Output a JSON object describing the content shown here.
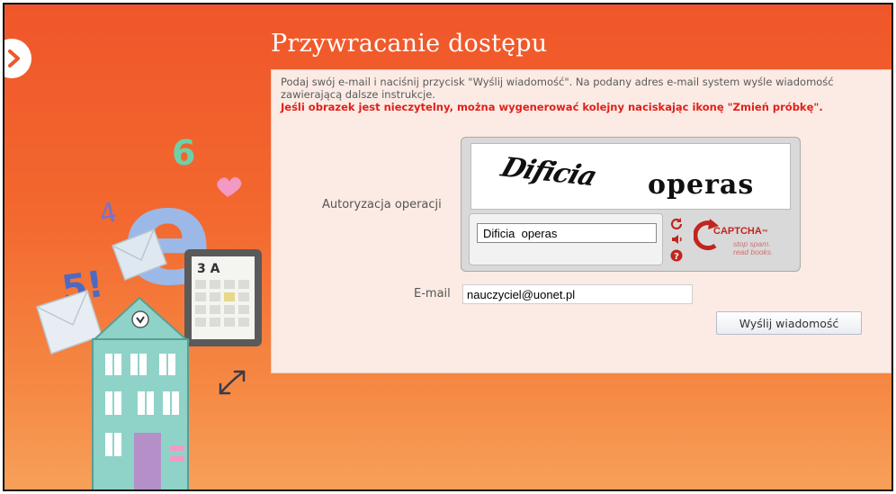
{
  "page": {
    "title": "Przywracanie dostępu",
    "info_text": "Podaj swój e-mail i naciśnij przycisk \"Wyślij wiadomość\". Na podany adres e-mail system wyśle wiadomość zawierającą dalsze instrukcje.",
    "warning_text": "Jeśli obrazek jest nieczytelny, można wygenerować kolejny naciskając ikonę \"Zmień próbkę\"."
  },
  "captcha": {
    "label": "Autoryzacja operacji",
    "word_1": "Dificia",
    "word_2": "operas",
    "input_value": "Dificia  operas",
    "logo_text": "CAPTCHA",
    "logo_tagline_1": "stop spam.",
    "logo_tagline_2": "read books.",
    "tm": "™"
  },
  "email": {
    "label": "E-mail",
    "value": "nauczyciel@uonet.pl"
  },
  "actions": {
    "send_label": "Wyślij wiadomość"
  },
  "illustration": {
    "digit_6": "6",
    "digit_5": "5!",
    "digit_4": "4",
    "letter_e": "e",
    "calendar_label": "3 A"
  },
  "colors": {
    "background": "#f0562a",
    "panel": "#fbebe4",
    "warning": "#e0201b",
    "house": "#8fd3c8"
  }
}
